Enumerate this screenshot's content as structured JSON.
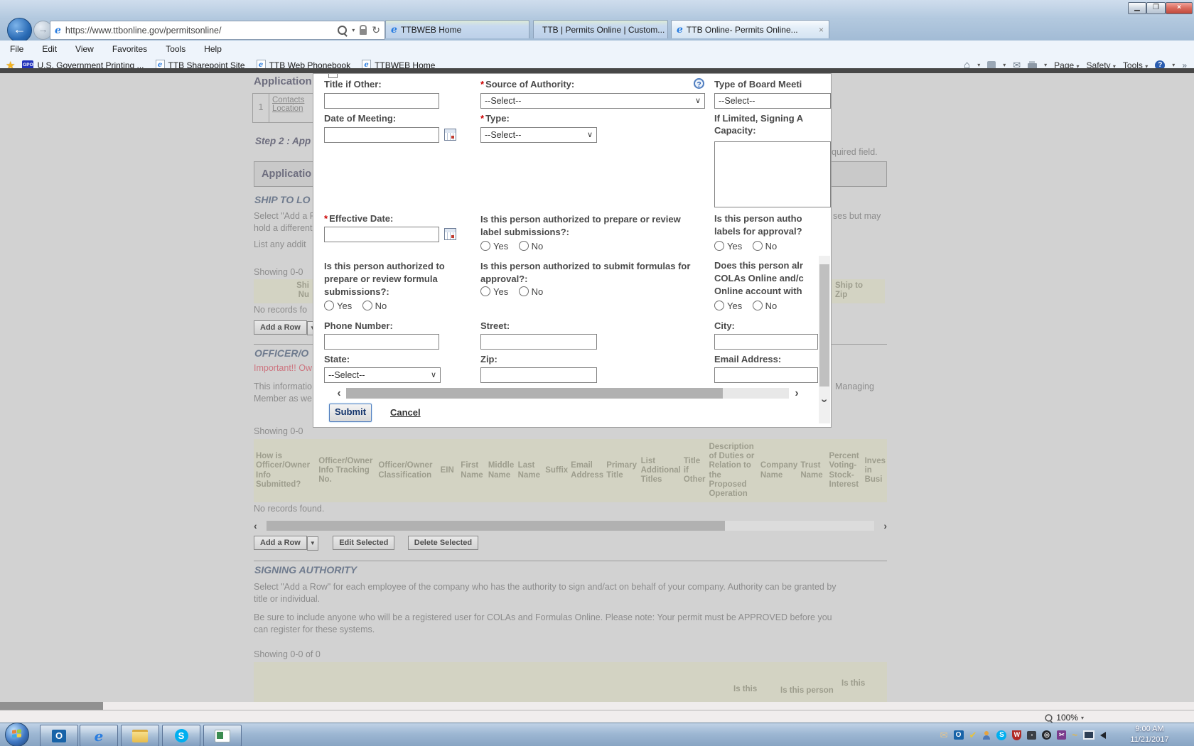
{
  "window": {
    "url": "https://www.ttbonline.gov/permitsonline/",
    "tabs": [
      {
        "label": "TTBWEB Home"
      },
      {
        "label": "TTB | Permits Online | Custom..."
      },
      {
        "label": "TTB Online- Permits Online...",
        "close": "×"
      }
    ],
    "menu": [
      "File",
      "Edit",
      "View",
      "Favorites",
      "Tools",
      "Help"
    ],
    "favorites_bar": {
      "gpo_badge": "GPO",
      "items": [
        "U.S. Government Printing ...",
        "TTB Sharepoint Site",
        "TTB Web Phonebook",
        "TTBWEB Home"
      ]
    },
    "commands": {
      "page": "Page",
      "safety": "Safety",
      "tools": "Tools",
      "overflow": "»"
    }
  },
  "page": {
    "app_heading": "Application",
    "contacts_row": {
      "num": "1",
      "link1": "Contacts",
      "link2": "Location"
    },
    "step2": "Step 2 : App",
    "required_fragment": "quired field.",
    "section_bar": "Applicatio",
    "ship_to_heading": "SHIP TO LO",
    "ship_p1_left1": "Select \"Add a F",
    "ship_p1_left2": "hold a different",
    "ship_p1_right": "ses but may",
    "ship_p2": "List any addit",
    "showing1": "Showing 0-0",
    "ship_header_left1": "Shi",
    "ship_header_left2": "Nu",
    "ship_header_right1": "Ship to",
    "ship_header_right2": "Zip",
    "no_records1": "No records fo",
    "add_row_btn": "Add a Row",
    "officer_heading": "OFFICER/O",
    "important_fragment": "Important!! Ow",
    "officer_p_left1": "This informatio",
    "officer_p_left2": "Member as we",
    "officer_p_right": "Managing",
    "showing2": "Showing 0-0",
    "officer_table_cols": [
      "How is Officer/Owner Info Submitted?",
      "Officer/Owner Info Tracking No.",
      "Officer/Owner Classification",
      "EIN",
      "First Name",
      "Middle Name",
      "Last Name",
      "Suffix",
      "Email Address",
      "Primary Title",
      "List Additional Titles",
      "Title if Other",
      "Description of Duties or Relation to the Proposed Operation",
      "Company Name",
      "Trust Name",
      "Percent Voting- Stock- Interest",
      "Inves in Busi"
    ],
    "no_records2": "No records found.",
    "edit_selected_btn": "Edit Selected",
    "delete_selected_btn": "Delete Selected",
    "signing_heading": "SIGNING AUTHORITY",
    "signing_p1": "Select \"Add a Row\" for each employee of the company who has the authority to sign and/act on behalf of your company. Authority can be granted by title or individual.",
    "signing_p2": "Be sure to include anyone who will be a registered user for COLAs and Formulas Online. Please note: Your permit must be APPROVED before you can register for these systems.",
    "showing3": "Showing 0-0 of 0",
    "bottom_cols": [
      "Is this",
      "Is this person",
      "Is this"
    ]
  },
  "modal": {
    "required_mark": "*",
    "select_value": "--Select--",
    "yes": "Yes",
    "no": "No",
    "labels": {
      "title_if_other": "Title if Other:",
      "source_of_authority": "Source of Authority:",
      "board_meeting": "Type of Board Meeti",
      "date_of_meeting": "Date of Meeting:",
      "type": "Type:",
      "if_limited_1": "If Limited, Signing A",
      "if_limited_2": "Capacity:",
      "effective_date": "Effective Date:",
      "q_label": "Is this person authorized to prepare or review label submissions?:",
      "q_approve_1": "Is this person autho",
      "q_approve_2": "labels for approval?",
      "q_formula": "Is this person authorized to prepare or review formula submissions?:",
      "q_submit_formula": "Is this person authorized to submit formulas for approval?:",
      "q_colas_1": "Does this person alr",
      "q_colas_2": "COLAs Online and/c",
      "q_colas_3": "Online account with",
      "phone": "Phone Number:",
      "street": "Street:",
      "city": "City:",
      "state": "State:",
      "zip": "Zip:",
      "email": "Email Address:"
    },
    "submit": "Submit",
    "cancel": "Cancel"
  },
  "status": {
    "zoom_level": "100%"
  },
  "taskbar": {
    "time": "9:00 AM",
    "date": "11/21/2017"
  }
}
